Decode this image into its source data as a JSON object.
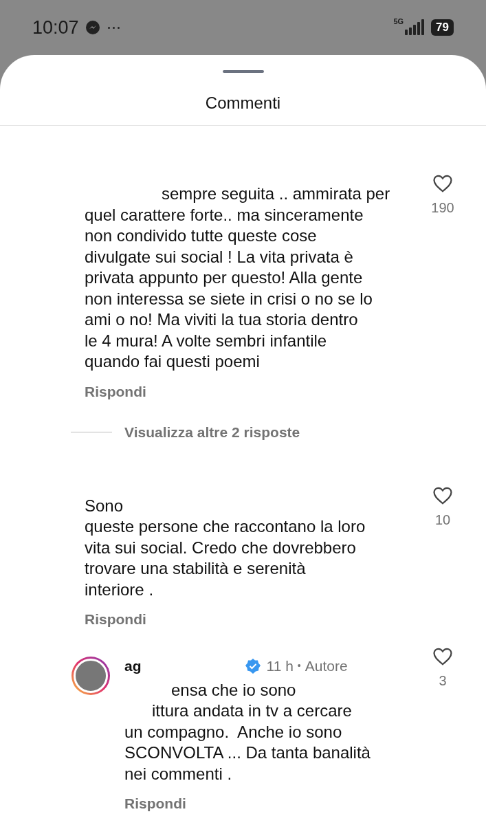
{
  "status_bar": {
    "time": "10:07",
    "network": "5G",
    "battery": "79"
  },
  "sheet": {
    "title": "Commenti"
  },
  "comments": [
    {
      "kind": "comment",
      "lines": [
        "sempre seguita .. ammirata per",
        "quel carattere forte.. ma sinceramente",
        "non condivido tutte queste cose",
        "divulgate sui social ! La vita privata è",
        "privata appunto per questo! Alla gente",
        "non interessa se siete in crisi o no se lo",
        "ami o no! Ma viviti la tua storia dentro",
        "le 4 mura! A volte sembri infantile",
        "quando fai questi poemi"
      ],
      "likes": "190",
      "reply": "Rispondi",
      "more_replies": "Visualizza altre 2 risposte"
    },
    {
      "kind": "comment",
      "lines": [
        "Sono",
        "queste persone che raccontano la loro",
        "vita sui social. Credo che dovrebbero",
        "trovare una stabilità e serenità",
        "interiore ."
      ],
      "likes": "10",
      "reply": "Rispondi"
    },
    {
      "kind": "reply",
      "username": "ag",
      "verified": true,
      "time": "11 h",
      "separator": "•",
      "badge": "Autore",
      "lines": [
        "ensa che io sono",
        "ittura andata in tv a cercare",
        "un compagno.  Anche io sono",
        "SCONVOLTA ... Da tanta banalità",
        "nei commenti ."
      ],
      "likes": "3",
      "reply": "Rispondi"
    }
  ]
}
